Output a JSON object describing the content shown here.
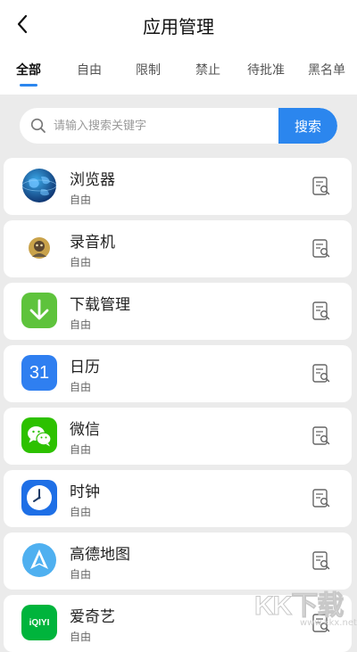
{
  "header": {
    "title": "应用管理",
    "back_icon": "chevron-left-icon"
  },
  "tabs": [
    {
      "label": "全部",
      "active": true
    },
    {
      "label": "自由",
      "active": false
    },
    {
      "label": "限制",
      "active": false
    },
    {
      "label": "禁止",
      "active": false
    },
    {
      "label": "待批准",
      "active": false
    },
    {
      "label": "黑名单",
      "active": false
    }
  ],
  "search": {
    "placeholder": "请输入搜索关键字",
    "value": "",
    "button_label": "搜索"
  },
  "apps": [
    {
      "name": "浏览器",
      "status": "自由",
      "icon": "browser-globe-icon"
    },
    {
      "name": "录音机",
      "status": "自由",
      "icon": "recorder-icon"
    },
    {
      "name": "下载管理",
      "status": "自由",
      "icon": "download-icon"
    },
    {
      "name": "日历",
      "status": "自由",
      "icon": "calendar-icon",
      "icon_text": "31"
    },
    {
      "name": "微信",
      "status": "自由",
      "icon": "wechat-icon"
    },
    {
      "name": "时钟",
      "status": "自由",
      "icon": "clock-icon"
    },
    {
      "name": "高德地图",
      "status": "自由",
      "icon": "amap-icon"
    },
    {
      "name": "爱奇艺",
      "status": "自由",
      "icon": "iqiyi-icon",
      "icon_text": "iQIYI"
    }
  ],
  "watermark": {
    "text": "KK下载",
    "url": "www.kkx.net"
  },
  "colors": {
    "accent": "#2b86ee",
    "background": "#ebebeb",
    "card": "#ffffff",
    "wechat": "#2dc100",
    "download": "#5ec33c"
  }
}
